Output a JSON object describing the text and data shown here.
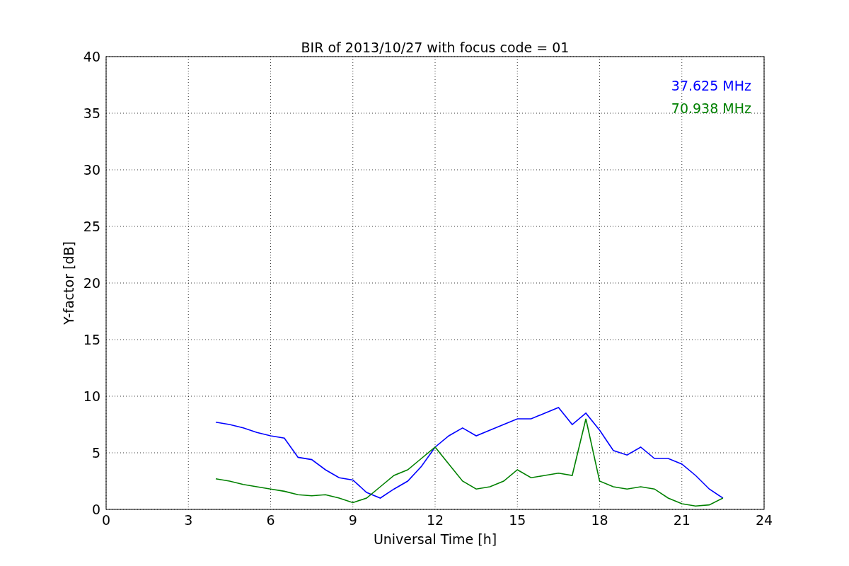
{
  "chart_data": {
    "type": "line",
    "title": "BIR of 2013/10/27 with focus code = 01",
    "xlabel": "Universal Time [h]",
    "ylabel": "Y-factor [dB]",
    "x": [
      4,
      4.5,
      5,
      5.5,
      6,
      6.5,
      7,
      7.5,
      8,
      8.5,
      9,
      9.5,
      10,
      10.5,
      11,
      11.5,
      12,
      12.5,
      13,
      13.5,
      14,
      14.5,
      15,
      15.5,
      16,
      16.5,
      17,
      17.5,
      18,
      18.5,
      19,
      19.5,
      20,
      20.5,
      21,
      21.5,
      22,
      22.5
    ],
    "series": [
      {
        "name": "37.625 MHz",
        "color": "#0000ff",
        "values": [
          7.7,
          7.5,
          7.2,
          6.8,
          6.5,
          6.3,
          4.6,
          4.4,
          3.5,
          2.8,
          2.6,
          1.5,
          1.0,
          1.8,
          2.5,
          3.8,
          5.5,
          6.5,
          7.2,
          6.5,
          7.0,
          7.5,
          8.0,
          8.0,
          8.5,
          9.0,
          7.5,
          8.5,
          7.0,
          5.2,
          4.8,
          5.5,
          4.5,
          4.5,
          4.0,
          3.0,
          1.8,
          1.0
        ]
      },
      {
        "name": "70.938 MHz",
        "color": "#008000",
        "values": [
          2.7,
          2.5,
          2.2,
          2.0,
          1.8,
          1.6,
          1.3,
          1.2,
          1.3,
          1.0,
          0.6,
          1.0,
          2.0,
          3.0,
          3.5,
          4.5,
          5.5,
          4.0,
          2.5,
          1.8,
          2.0,
          2.5,
          3.5,
          2.8,
          3.0,
          3.2,
          3.0,
          8.0,
          2.5,
          2.0,
          1.8,
          2.0,
          1.8,
          1.0,
          0.5,
          0.3,
          0.4,
          1.0
        ]
      }
    ],
    "grid": true,
    "xlim": [
      0,
      24
    ],
    "ylim": [
      0,
      40
    ],
    "xticks": [
      0,
      3,
      6,
      9,
      12,
      15,
      18,
      21,
      24
    ],
    "yticks": [
      0,
      5,
      10,
      15,
      20,
      25,
      30,
      35,
      40
    ]
  }
}
